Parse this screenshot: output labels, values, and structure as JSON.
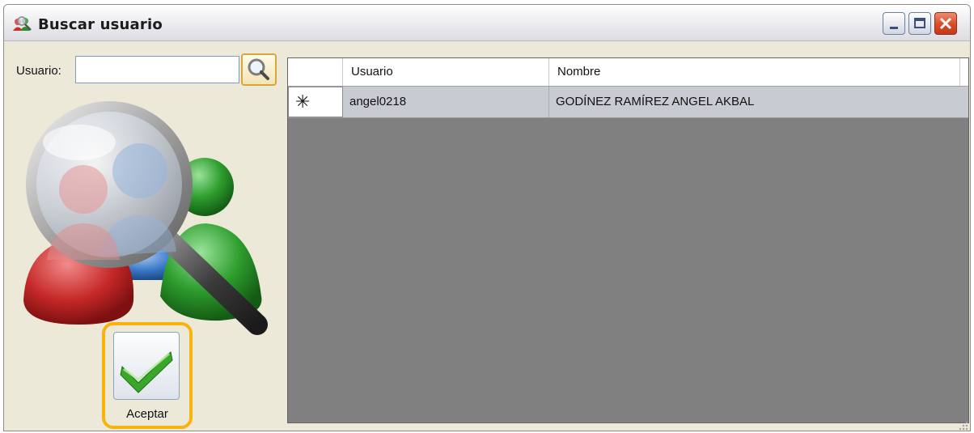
{
  "window": {
    "title": "Buscar usuario",
    "title_icon": "users-search-icon",
    "controls": [
      "minimize-icon",
      "maximize-icon",
      "close-icon"
    ]
  },
  "search": {
    "label": "Usuario:",
    "value": "",
    "placeholder": "",
    "button_icon": "magnifier-icon"
  },
  "illustration_icon": "users-magnifier-icon",
  "accept_button": {
    "label": "Aceptar",
    "icon": "checkmark-icon"
  },
  "grid": {
    "columns": [
      "Usuario",
      "Nombre"
    ],
    "rows": [
      {
        "marker": "✳",
        "usuario": "angel0218",
        "nombre": "GODÍNEZ RAMÍREZ ANGEL AKBAL"
      }
    ]
  },
  "colors": {
    "grid_background": "#808080",
    "row_background": "#c9cbd3",
    "highlight_border": "#f8b30f",
    "close_button": "#d94c26",
    "window_background": "#ece9d8"
  }
}
